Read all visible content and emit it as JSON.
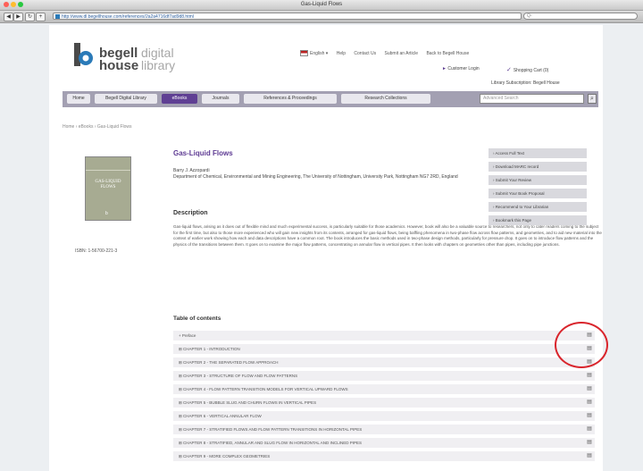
{
  "browser": {
    "window_title": "Gas-Liquid Flows",
    "url": "http://www.dl.begellhouse.com/references/2a2a4716df7ad9d8.html",
    "search_placeholder": "Q-",
    "colors": {
      "close": "#ff5f57",
      "min": "#febc2e",
      "max": "#28c840"
    }
  },
  "header": {
    "logo_word1": "begell",
    "logo_word2": "house",
    "logo_digital1": "digital",
    "logo_digital2": "library",
    "links": [
      "English",
      "Help",
      "Contact Us",
      "Submit an Article",
      "Back to Begell House"
    ],
    "customer_login": "Customer Login",
    "shopping_cart": "Shopping Cart (0)",
    "library_subscription": "Library Subscription: Begell House"
  },
  "nav": {
    "tabs": [
      "Home",
      "Begell Digital Library",
      "eBooks",
      "Journals",
      "References & Proceedings",
      "Research Collections"
    ],
    "active_index": 2,
    "search_placeholder": "Advanced Search",
    "accent": "#5f3f93"
  },
  "breadcrumb": "Home › eBooks › Gas-Liquid Flows",
  "book": {
    "cover_title": "GAS-LIQUID FLOWS",
    "cover_mark": "b",
    "isbn": "ISBN: 1-56700-221-3",
    "title": "Gas-Liquid Flows",
    "author": "Barry J. Azzopardi",
    "affiliation": "Department of Chemical, Environmental and Mining Engineering, The University of Nottingham, University Park, Nottingham NG7 2RD, England",
    "description_heading": "Description",
    "description": "Gas-liquid flows, arising as it does out of flexible mind and much experimental success, is particularly suitable for those academics. However, book will also be a valuable source to researchers, not only to cater readers coming to the subject for the first time, but also to those more experienced who will gain new insights from its contents, arranged for gas-liquid flows, being baffling phenomena in two-phase flow across flow patterns, and geometries, and to aid new material into the context of earlier work showing how each and data descriptions have a common root. The book introduces the basic methods used in two-phase design methods, particularly for pressure drop. It goes on to introduce flow patterns and the physics of the transitions between them. It goes on to examine the major flow patterns, concentrating on annular flow in vertical pipes. It then looks with chapters on geometries other than pipes, including pipe junctions."
  },
  "side_buttons": [
    "Access Full Text",
    "Download MARC record",
    "Submit Your Review",
    "Submit Your Book Proposal",
    "Recommend to Your Librarian",
    "Bookmark this Page"
  ],
  "toc": {
    "heading": "Table of contents",
    "rows": [
      "Preface",
      "CHAPTER 1 - INTRODUCTION",
      "CHAPTER 2 - THE SEPARATED FLOW APPROACH",
      "CHAPTER 3 - STRUCTURE OF FLOW AND FLOW PATTERNS",
      "CHAPTER 4 - FLOW PATTERN TRANSITION MODELS FOR VERTICAL UPWARD FLOWS",
      "CHAPTER 5 - BUBBLE SLUG AND CHURN FLOWS IN VERTICAL PIPES",
      "CHAPTER 6 - VERTICAL ANNULAR FLOW",
      "CHAPTER 7 - STRATIFIED FLOWS AND FLOW PATTERN TRANSITIONS IN HORIZONTAL PIPES",
      "CHAPTER 8 - STRATIFIED, ANNULAR AND SLUG FLOW IN HORIZONTAL AND INCLINED PIPES",
      "CHAPTER 9 - MORE COMPLEX GEOMETRIES"
    ],
    "highlight_color": "#d9252c"
  }
}
